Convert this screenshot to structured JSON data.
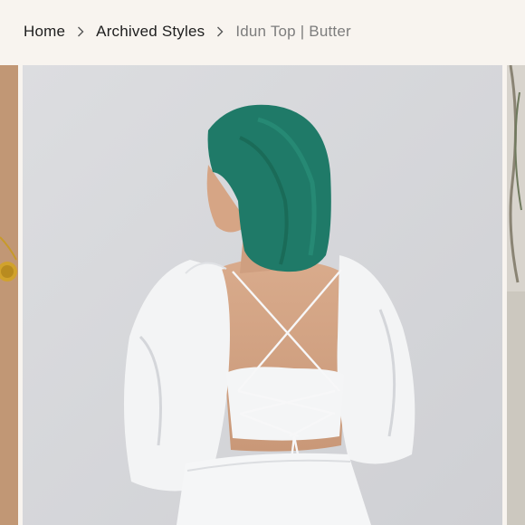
{
  "breadcrumb": {
    "items": [
      {
        "label": "Home"
      },
      {
        "label": "Archived Styles"
      }
    ],
    "current": "Idun Top | Butter",
    "separator_icon": "chevron-right-icon"
  },
  "gallery": {
    "slides": [
      {
        "subject": "previous-product-image"
      },
      {
        "subject": "person-with-teal-hair-in-white-open-back-top"
      },
      {
        "subject": "next-product-image"
      }
    ]
  },
  "colors": {
    "header_bg": "#f8f4ef",
    "link_text": "#1e1e1e",
    "current_text": "#7d7d7d",
    "photo_bg": "#d8d9dc",
    "hair": "#1f7a68",
    "garment": "#f4f5f6"
  }
}
